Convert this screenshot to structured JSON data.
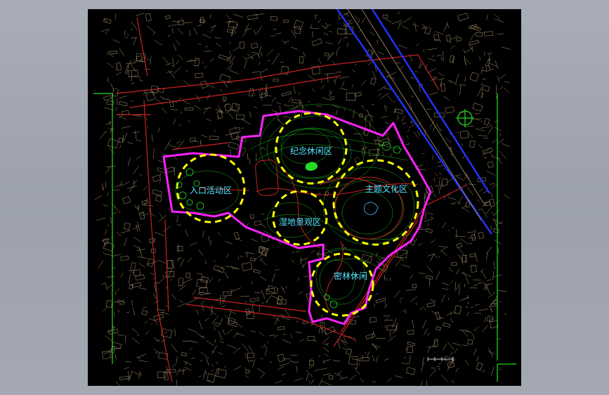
{
  "zones": [
    {
      "id": "entrance",
      "label": "入口活动区"
    },
    {
      "id": "memorial",
      "label": "纪念休闲区"
    },
    {
      "id": "culture",
      "label": "主题文化区"
    },
    {
      "id": "wetland",
      "label": "湿地景观区"
    },
    {
      "id": "forest",
      "label": "密林休闲"
    }
  ],
  "colors": {
    "background": "#000000",
    "boundary": "#ff22ff",
    "zone_circle": "#ffff00",
    "contour": "#22cc22",
    "roads": "#cc2222",
    "buildings": "#b09870",
    "rail": "#2233ff",
    "label": "#55e6ff"
  },
  "icons": [
    "north-arrow-icon",
    "scale-bar-icon"
  ]
}
